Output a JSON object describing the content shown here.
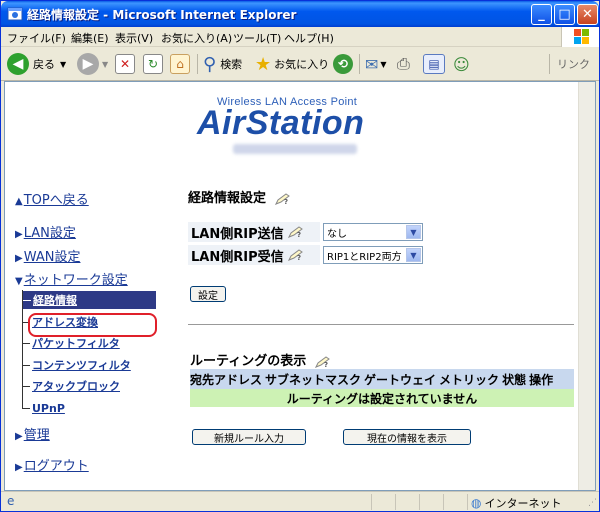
{
  "window": {
    "title": "経路情報設定 - Microsoft Internet Explorer",
    "minimize": "_",
    "maximize": "□",
    "close": "✕"
  },
  "menu": [
    "ファイル(F)",
    "編集(E)",
    "表示(V)",
    "お気に入り(A)",
    "ツール(T)",
    "ヘルプ(H)"
  ],
  "toolbar": {
    "back_label": "戻る",
    "search_label": "検索",
    "favorites_label": "お気に入り",
    "links_label": "リンク"
  },
  "logo": {
    "tagline": "Wireless LAN Access Point",
    "name": "AirStation"
  },
  "nav": {
    "top": "TOPへ戻る",
    "lan": "LAN設定",
    "wan": "WAN設定",
    "network": "ネットワーク設定",
    "sub": [
      "経路情報",
      "アドレス変換",
      "パケットフィルタ",
      "コンテンツフィルタ",
      "アタックブロック",
      "UPnP"
    ],
    "admin": "管理",
    "logout": "ログアウト"
  },
  "main": {
    "title": "経路情報設定",
    "rip_send_label": "LAN側RIP送信",
    "rip_send_value": "なし",
    "rip_recv_label": "LAN側RIP受信",
    "rip_recv_value": "RIP1とRIP2両方",
    "set_button": "設定",
    "routing_title": "ルーティングの表示",
    "columns": [
      "宛先アドレス",
      "サブネットマスク",
      "ゲートウェイ",
      "メトリック",
      "状態",
      "操作"
    ],
    "empty_message": "ルーティングは設定されていません",
    "new_rule_button": "新規ルール入力",
    "show_current_button": "現在の情報を表示"
  },
  "status": {
    "zone": "インターネット"
  },
  "colors": {
    "title_bar": "#0054e3",
    "nav_active_bg": "#2e3a86",
    "highlight": "#e0202a",
    "table_header": "#c8d8ee",
    "table_empty": "#cdf2b4"
  }
}
